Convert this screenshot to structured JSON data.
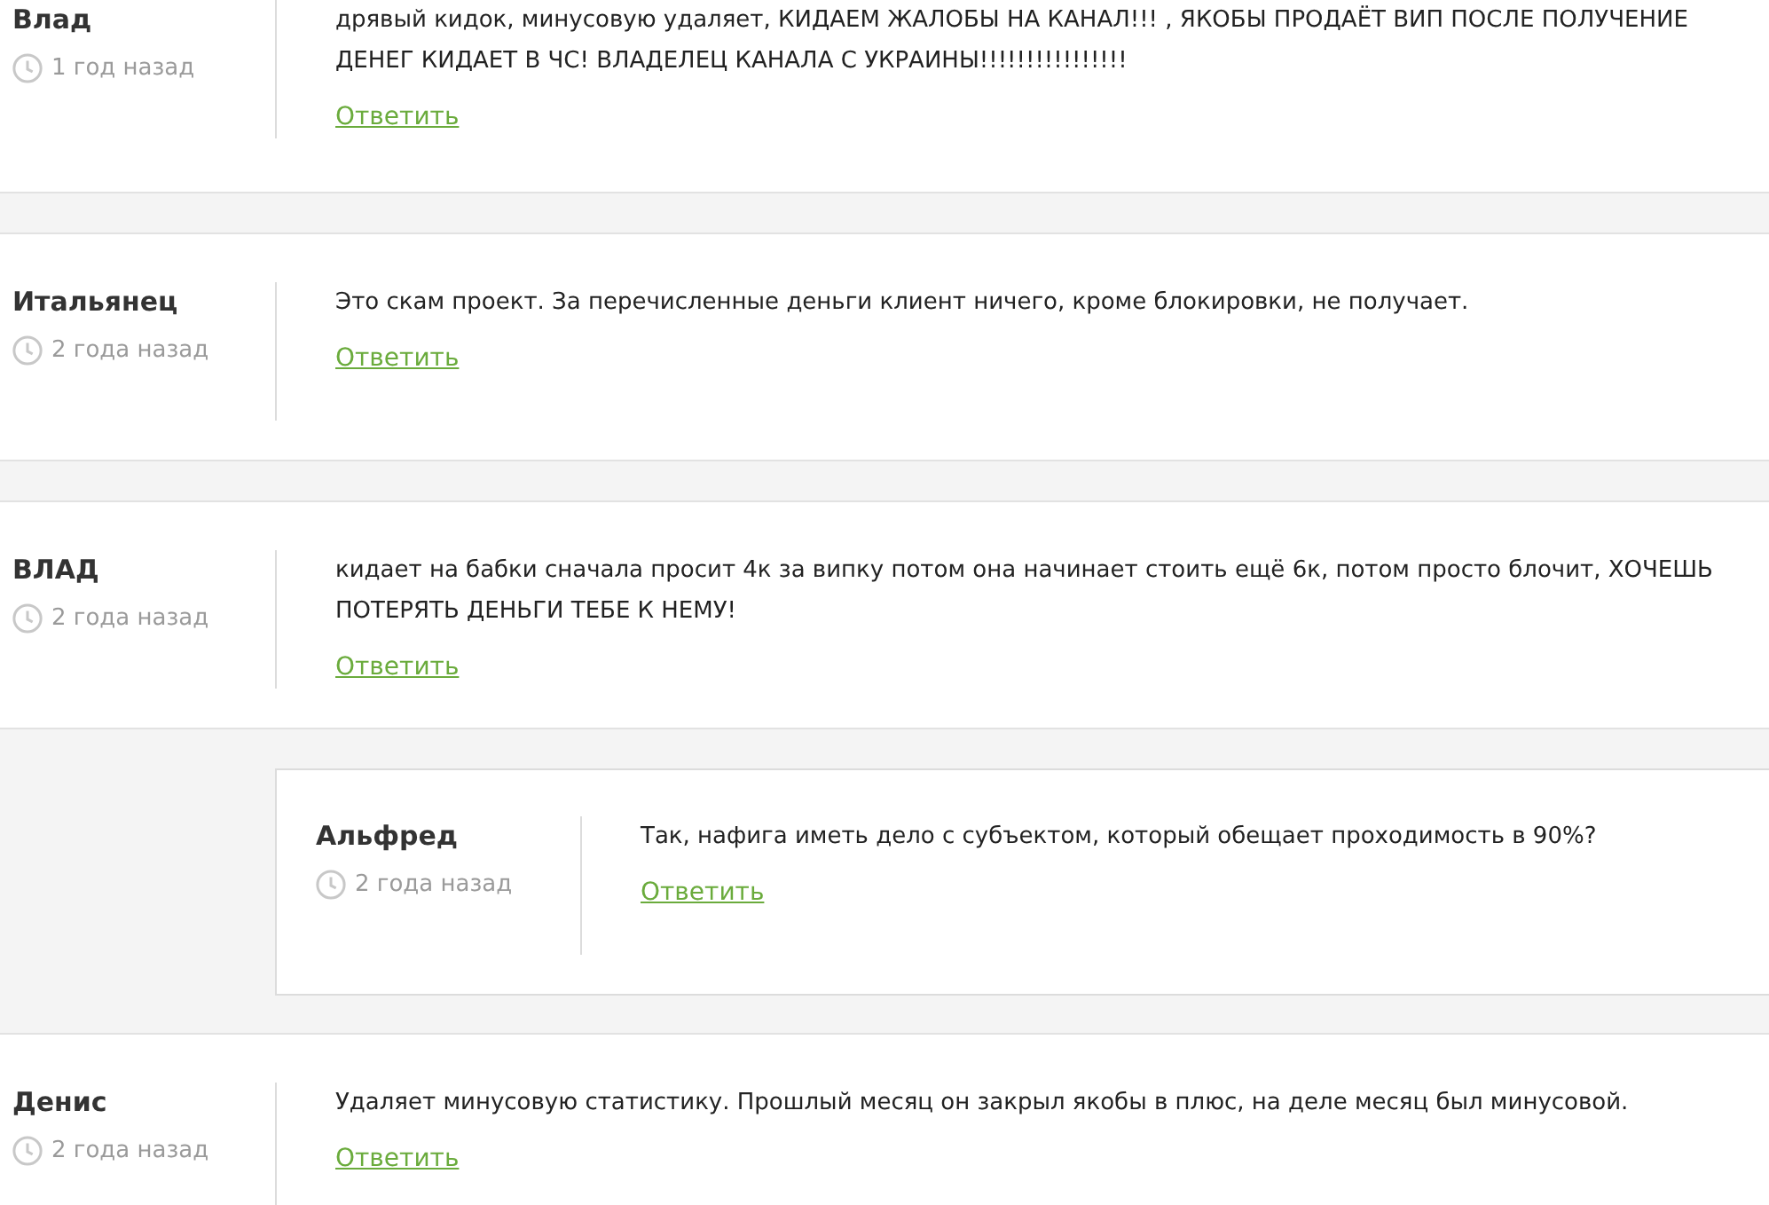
{
  "comments": [
    {
      "author": "Влад",
      "time": "1 год назад",
      "text": "дрявый кидок, минусовую удаляет, КИДАЕМ ЖАЛОБЫ НА КАНАЛ!!! , ЯКОБЫ ПРОДАЁТ ВИП ПОСЛЕ ПОЛУЧЕНИЕ ДЕНЕГ КИДАЕТ В ЧС! ВЛАДЕЛЕЦ КАНАЛА С УКРАИНЫ!!!!!!!!!!!!!!!!",
      "reply": "Ответить"
    },
    {
      "author": "Итальянец",
      "time": "2 года назад",
      "text": "Это скам проект. За перечисленные деньги клиент ничего, кроме блокировки, не получает.",
      "reply": "Ответить"
    },
    {
      "author": "ВЛАД",
      "time": "2 года назад",
      "text": "кидает на бабки сначала просит 4к за випку потом она начинает стоить ещё 6к, потом просто блочит, ХОЧЕШЬ ПОТЕРЯТЬ ДЕНЬГИ ТЕБЕ К НЕМУ!",
      "reply": "Ответить",
      "children": [
        {
          "author": "Альфред",
          "time": "2 года назад",
          "text": "Так, нафига иметь дело с субъектом, который обещает проходимость в 90%?",
          "reply": "Ответить"
        }
      ]
    },
    {
      "author": "Денис",
      "time": "2 года назад",
      "text": "Удаляет минусовую статистику. Прошлый месяц он закрыл якобы в плюс, на деле месяц был минусовой.",
      "reply": "Ответить"
    }
  ]
}
